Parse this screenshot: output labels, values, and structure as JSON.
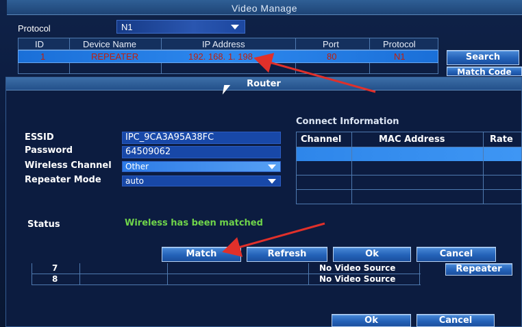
{
  "video_manage": {
    "title": "Video Manage",
    "protocol_label": "Protocol",
    "protocol_value": "N1",
    "columns": [
      "ID",
      "Device Name",
      "IP Address",
      "Port",
      "Protocol"
    ],
    "rows": [
      {
        "id": "1",
        "device_name": "REPEATER",
        "ip": "192. 168. 1. 198",
        "port": "80",
        "protocol": "N1"
      }
    ],
    "search_label": "Search",
    "match_code_label": "Match Code"
  },
  "router": {
    "title": "Router",
    "essid_label": "ESSID",
    "essid_value": "IPC_9CA3A95A38FC",
    "password_label": "Password",
    "password_value": "64509062",
    "channel_label": "Wireless Channel",
    "channel_value": "Other",
    "mode_label": "Repeater Mode",
    "mode_value": "auto",
    "connect_info_title": "Connect Information",
    "ci_columns": [
      "Channel",
      "MAC Address",
      "Rate"
    ],
    "status_label": "Status",
    "status_value": "Wireless has been matched",
    "status_color": "#6fd44a",
    "buttons": {
      "match": "Match",
      "refresh": "Refresh",
      "ok": "Ok",
      "cancel": "Cancel"
    }
  },
  "channel_list": {
    "rows": [
      {
        "num": "7",
        "source": "No Video Source"
      },
      {
        "num": "8",
        "source": "No Video Source"
      }
    ],
    "repeater_label": "Repeater",
    "ok_label": "Ok",
    "cancel_label": "Cancel"
  },
  "annotation_color": "#e0302a"
}
